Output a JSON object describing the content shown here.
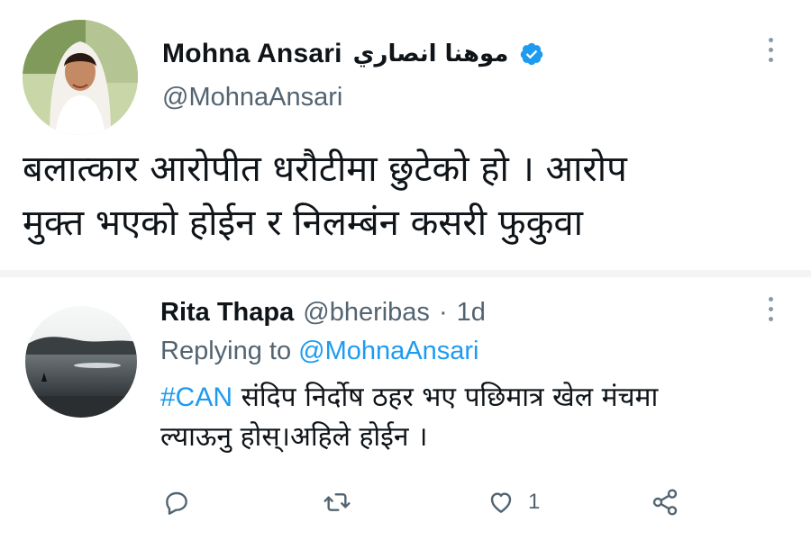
{
  "tweet": {
    "author_name": "Mohna Ansari",
    "author_name_arabic": "موهنا انصاري",
    "handle": "@MohnaAnsari",
    "verified": true,
    "text_lines": [
      "बलात्कार आरोपीत धरौटीमा छुटेको हो । आरोप",
      "मुक्त भएको होईन र निलम्बंन कसरी फुकुवा"
    ]
  },
  "reply": {
    "author_name": "Rita Thapa",
    "handle": "@bheribas",
    "separator": "·",
    "time": "1d",
    "replying_to_label": "Replying to",
    "replying_to_handle": "@MohnaAnsari",
    "hashtag": "#CAN",
    "text_line1_rest": " संदिप निर्दोष ठहर भए पछिमात्र खेल मंचमा",
    "text_line2": "ल्याऊनु होस्।अहिले होईन ।",
    "actions": {
      "reply_icon": "reply-icon",
      "retweet_icon": "retweet-icon",
      "like_icon": "like-icon",
      "like_count": "1",
      "share_icon": "share-icon"
    }
  },
  "colors": {
    "accent": "#1d9bf0",
    "secondary_text": "#536471",
    "primary_text": "#0f1419"
  }
}
